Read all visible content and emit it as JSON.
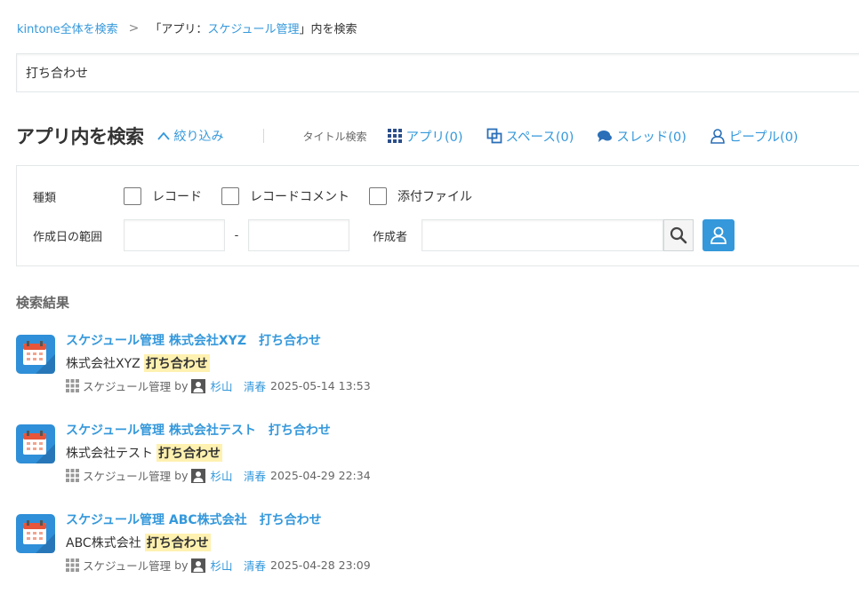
{
  "breadcrumb": {
    "root": "kintone全体を検索",
    "separator": ">",
    "scope_prefix": "「アプリ：",
    "scope_app": "スケジュール管理",
    "scope_suffix": "」内を検索"
  },
  "search": {
    "value": "打ち合わせ"
  },
  "header": {
    "title": "アプリ内を検索",
    "narrow_label": "絞り込み",
    "title_search_label": "タイトル検索",
    "tabs": [
      {
        "icon": "grid-icon",
        "label": "アプリ(0)"
      },
      {
        "icon": "space-icon",
        "label": "スペース(0)"
      },
      {
        "icon": "thread-icon",
        "label": "スレッド(0)"
      },
      {
        "icon": "people-icon",
        "label": "ピープル(0)"
      }
    ]
  },
  "filters": {
    "type_label": "種類",
    "types": [
      {
        "label": "レコード",
        "checked": false
      },
      {
        "label": "レコードコメント",
        "checked": false
      },
      {
        "label": "添付ファイル",
        "checked": false
      }
    ],
    "date_range_label": "作成日の範囲",
    "date_separator": "-",
    "date_from": "",
    "date_to": "",
    "creator_label": "作成者",
    "creator_value": ""
  },
  "results": {
    "heading": "検索結果",
    "items": [
      {
        "app": "スケジュール管理",
        "title_main": "スケジュール管理 株式会社XYZ",
        "title_keyword": "打ち合わせ",
        "body_text": "株式会社XYZ",
        "body_highlight": "打ち合わせ",
        "meta_app": "スケジュール管理",
        "meta_by": "by",
        "user": "杉山　清春",
        "datetime": "2025-05-14 13:53"
      },
      {
        "app": "スケジュール管理",
        "title_main": "スケジュール管理 株式会社テスト",
        "title_keyword": "打ち合わせ",
        "body_text": "株式会社テスト",
        "body_highlight": "打ち合わせ",
        "meta_app": "スケジュール管理",
        "meta_by": "by",
        "user": "杉山　清春",
        "datetime": "2025-04-29 22:34"
      },
      {
        "app": "スケジュール管理",
        "title_main": "スケジュール管理 ABC株式会社",
        "title_keyword": "打ち合わせ",
        "body_text": "ABC株式会社",
        "body_highlight": "打ち合わせ",
        "meta_app": "スケジュール管理",
        "meta_by": "by",
        "user": "杉山　清春",
        "datetime": "2025-04-28 23:09"
      }
    ]
  },
  "colors": {
    "link": "#3498db",
    "highlight": "#fff1b0",
    "app_icon_bg": "#2f8fd8",
    "calendar_header": "#e7553a"
  }
}
